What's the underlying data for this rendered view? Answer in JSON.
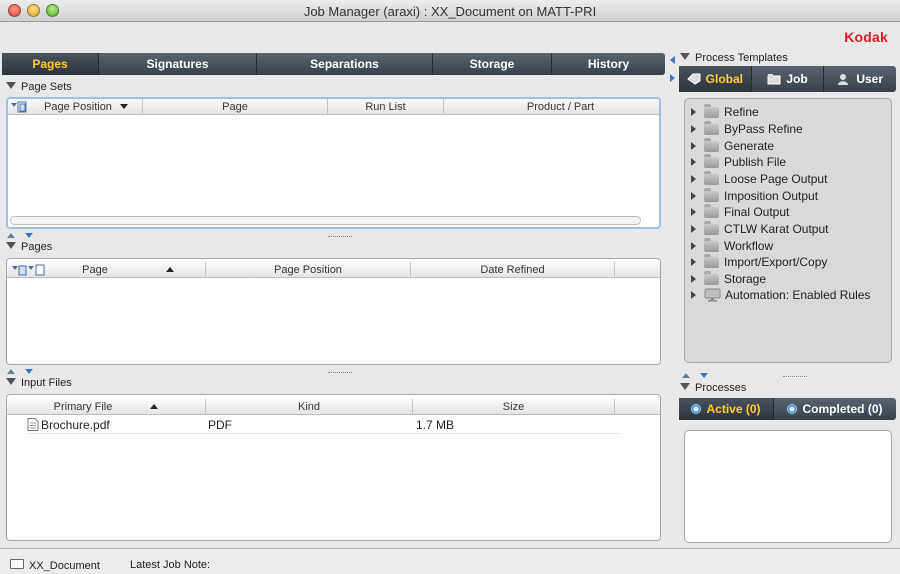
{
  "window": {
    "title": "Job Manager (araxi) : XX_Document on MATT-PRI"
  },
  "brand": {
    "logo": "Kodak",
    "color": "#d1202a"
  },
  "main_tabs": [
    {
      "label": "Pages",
      "active": true
    },
    {
      "label": "Signatures",
      "active": false
    },
    {
      "label": "Separations",
      "active": false
    },
    {
      "label": "Storage",
      "active": false
    },
    {
      "label": "History",
      "active": false
    }
  ],
  "page_sets": {
    "label": "Page Sets",
    "columns": [
      "Page Position",
      "Page",
      "Run List",
      "Product / Part"
    ]
  },
  "pages": {
    "label": "Pages",
    "columns": [
      "Page",
      "Page Position",
      "Date Refined"
    ]
  },
  "input_files": {
    "label": "Input Files",
    "columns": [
      "Primary File",
      "Kind",
      "Size"
    ],
    "rows": [
      {
        "file": "Brochure.pdf",
        "kind": "PDF",
        "size": "1.7 MB"
      }
    ]
  },
  "process_templates": {
    "label": "Process Templates",
    "tabs": [
      "Global",
      "Job",
      "User"
    ],
    "items": [
      "Refine",
      "ByPass Refine",
      "Generate",
      "Publish File",
      "Loose Page Output",
      "Imposition Output",
      "Final Output",
      "CTLW Karat Output",
      "Workflow",
      "Import/Export/Copy",
      "Storage",
      "Automation: Enabled Rules"
    ]
  },
  "processes": {
    "label": "Processes",
    "tabs": [
      "Active (0)",
      "Completed (0)"
    ]
  },
  "status": {
    "document": "XX_Document",
    "latest_note_label": "Latest Job Note:"
  },
  "colors": {
    "accent": "#ffcc33",
    "tab_dark": "#38414c",
    "link_blue": "#3b77c8"
  }
}
